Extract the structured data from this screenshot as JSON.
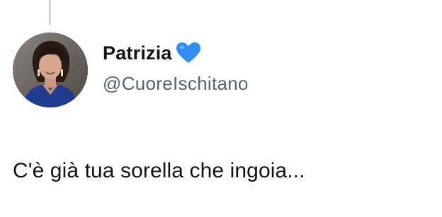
{
  "tweet": {
    "author": {
      "display_name": "Patrizia",
      "name_emoji": "blue-heart-icon",
      "handle": "@CuoreIschitano",
      "avatar": "profile-photo"
    },
    "text": "C'è già tua sorella che ingoia..."
  },
  "colors": {
    "text_primary": "#0f1419",
    "text_secondary": "#536471",
    "thread_line": "#cfd9de",
    "heart": "#2f8ef4"
  }
}
